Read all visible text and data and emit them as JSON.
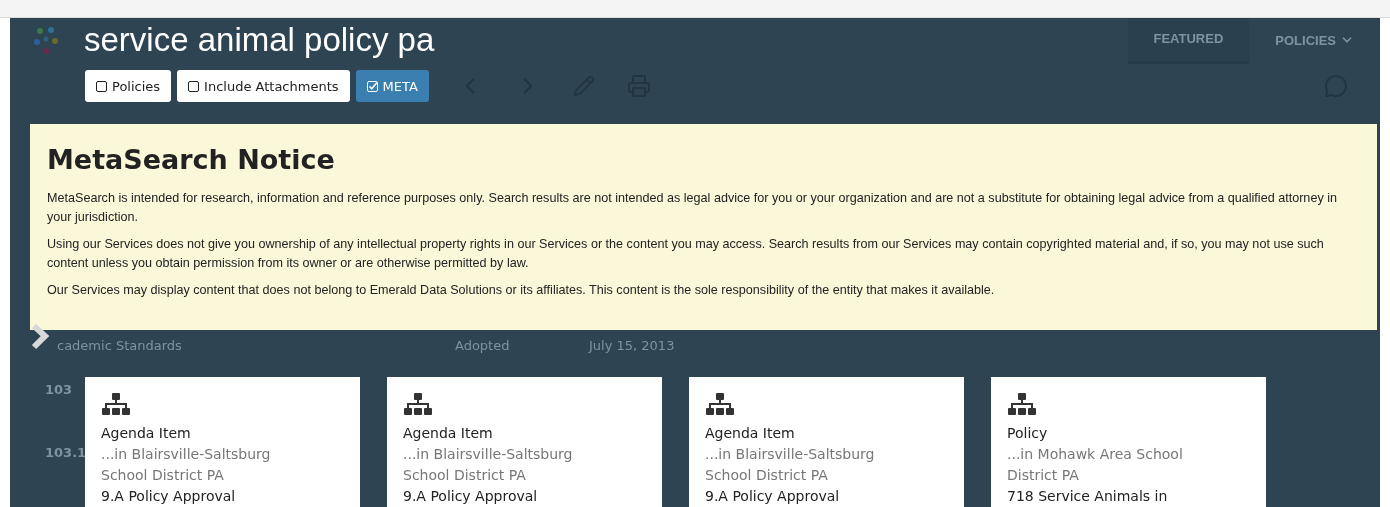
{
  "header": {
    "title": "service animal policy pa",
    "nav": [
      {
        "label": "FEATURED",
        "selected": true
      },
      {
        "label": "POLICIES",
        "selected": false
      }
    ]
  },
  "filters": [
    {
      "label": "Policies",
      "checked": false
    },
    {
      "label": "Include Attachments",
      "checked": false
    },
    {
      "label": "META",
      "checked": true
    }
  ],
  "notice": {
    "title": "MetaSearch Notice",
    "paragraphs": [
      "MetaSearch is intended for research, information and reference purposes only. Search results are not intended as legal advice for you or your organization and are not a substitute for obtaining legal advice from a qualified attorney in your jurisdiction.",
      "Using our Services does not give you ownership of any intellectual property rights in our Services or the content you may access. Search results from our Services may contain copyrighted material and, if so, you may not use such content unless you obtain permission from its owner or are otherwise permitted by law.",
      "Our Services may display content that does not belong to Emerald Data Solutions or its affiliates. This content is the sole responsibility of the entity that makes it available."
    ]
  },
  "background_row": {
    "column_1": "cademic Standards",
    "column_2": "Adopted",
    "column_3": "July 15, 2013"
  },
  "background_codes": [
    "103",
    "103.1"
  ],
  "results": [
    {
      "type": "Agenda Item",
      "source": "...in Blairsville-Saltsburg School District PA",
      "title": "9.A Policy Approval"
    },
    {
      "type": "Agenda Item",
      "source": "...in Blairsville-Saltsburg School District PA",
      "title": "9.A Policy Approval"
    },
    {
      "type": "Agenda Item",
      "source": "...in Blairsville-Saltsburg School District PA",
      "title": "9.A Policy Approval"
    },
    {
      "type": "Policy",
      "source": "...in Mohawk Area School District PA",
      "title": "718 Service Animals in"
    }
  ]
}
